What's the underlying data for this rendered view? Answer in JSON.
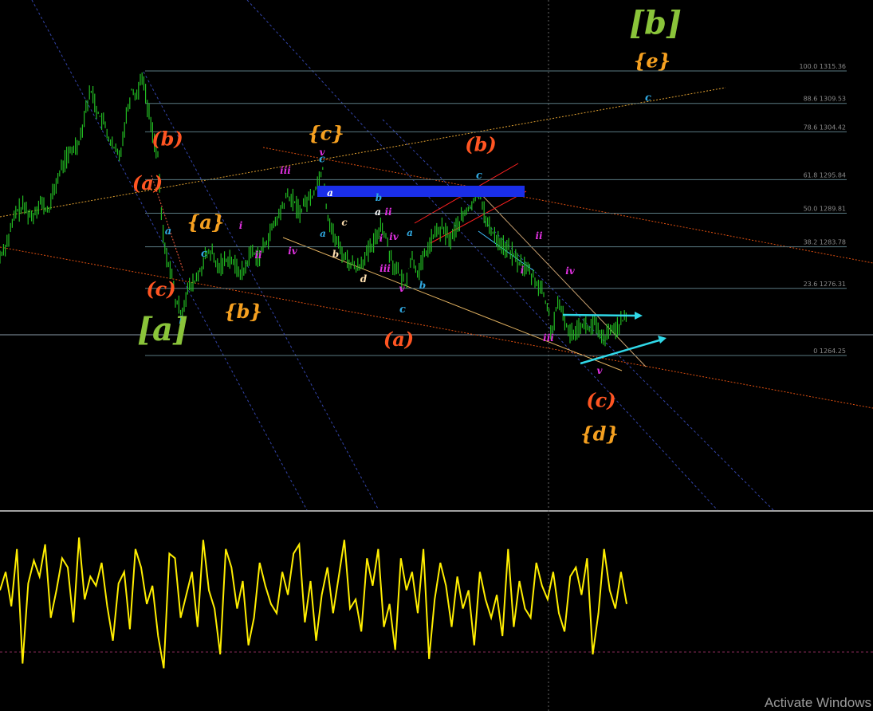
{
  "chart_data": [
    {
      "type": "line",
      "panel": "price",
      "title": "",
      "colors": {
        "bars": "#22bb22",
        "background": "#000000",
        "fib_lines": "#5a7a82"
      },
      "fib_levels": [
        {
          "label": "100.0 1315.36",
          "price": 1315.36
        },
        {
          "label": "88.6 1309.53",
          "price": 1309.53
        },
        {
          "label": "78.6 1304.42",
          "price": 1304.42
        },
        {
          "label": "61.8 1295.84",
          "price": 1295.84
        },
        {
          "label": "50.0 1289.81",
          "price": 1289.81
        },
        {
          "label": "38.2 1283.78",
          "price": 1283.78
        },
        {
          "label": "23.6 1276.31",
          "price": 1276.31
        },
        {
          "label": "0 1264.25",
          "price": 1264.25
        }
      ],
      "price_path": [
        [
          0,
          1282
        ],
        [
          10,
          1285
        ],
        [
          20,
          1290
        ],
        [
          30,
          1291
        ],
        [
          40,
          1289
        ],
        [
          50,
          1292
        ],
        [
          60,
          1290
        ],
        [
          70,
          1295
        ],
        [
          80,
          1299
        ],
        [
          90,
          1301
        ],
        [
          100,
          1303
        ],
        [
          108,
          1309
        ],
        [
          115,
          1312
        ],
        [
          122,
          1308
        ],
        [
          130,
          1306
        ],
        [
          140,
          1302
        ],
        [
          150,
          1300
        ],
        [
          158,
          1307
        ],
        [
          165,
          1312
        ],
        [
          172,
          1311
        ],
        [
          178,
          1315
        ],
        [
          185,
          1309
        ],
        [
          192,
          1304
        ],
        [
          198,
          1300
        ],
        [
          203,
          1288
        ],
        [
          208,
          1282
        ],
        [
          214,
          1280
        ],
        [
          220,
          1274
        ],
        [
          228,
          1272
        ],
        [
          235,
          1276
        ],
        [
          242,
          1277
        ],
        [
          250,
          1279
        ],
        [
          258,
          1282
        ],
        [
          265,
          1283
        ],
        [
          272,
          1280
        ],
        [
          280,
          1281
        ],
        [
          288,
          1282
        ],
        [
          296,
          1280
        ],
        [
          305,
          1279
        ],
        [
          315,
          1283
        ],
        [
          325,
          1282
        ],
        [
          335,
          1285
        ],
        [
          345,
          1288
        ],
        [
          352,
          1290
        ],
        [
          360,
          1293
        ],
        [
          368,
          1292
        ],
        [
          376,
          1290
        ],
        [
          384,
          1292
        ],
        [
          392,
          1293
        ],
        [
          400,
          1296
        ],
        [
          405,
          1298
        ],
        [
          410,
          1290
        ],
        [
          418,
          1286
        ],
        [
          428,
          1283
        ],
        [
          438,
          1281
        ],
        [
          448,
          1280
        ],
        [
          458,
          1282
        ],
        [
          468,
          1284
        ],
        [
          478,
          1288
        ],
        [
          485,
          1285
        ],
        [
          492,
          1281
        ],
        [
          500,
          1279
        ],
        [
          508,
          1277
        ],
        [
          516,
          1282
        ],
        [
          525,
          1279
        ],
        [
          535,
          1283
        ],
        [
          545,
          1286
        ],
        [
          555,
          1287
        ],
        [
          565,
          1285
        ],
        [
          575,
          1288
        ],
        [
          585,
          1290
        ],
        [
          595,
          1292
        ],
        [
          602,
          1294
        ],
        [
          610,
          1288
        ],
        [
          620,
          1286
        ],
        [
          630,
          1284
        ],
        [
          640,
          1283
        ],
        [
          650,
          1281
        ],
        [
          660,
          1280
        ],
        [
          670,
          1278
        ],
        [
          680,
          1276
        ],
        [
          688,
          1272
        ],
        [
          692,
          1268
        ],
        [
          698,
          1273
        ],
        [
          706,
          1272
        ],
        [
          714,
          1268
        ],
        [
          722,
          1269
        ],
        [
          730,
          1270
        ],
        [
          738,
          1269
        ],
        [
          746,
          1270
        ],
        [
          754,
          1267
        ],
        [
          762,
          1268
        ],
        [
          770,
          1269
        ],
        [
          778,
          1270
        ],
        [
          786,
          1271
        ]
      ],
      "wave_labels": [
        {
          "text": "[b]",
          "color": "#8ac43a",
          "at": [
            822,
            1322
          ],
          "size": "xl"
        },
        {
          "text": "{e}",
          "color": "#f5a020",
          "at": [
            818,
            1316
          ],
          "size": "l"
        },
        {
          "text": "c",
          "color": "#30a8e0",
          "at": [
            813,
            1310
          ],
          "size": "s"
        },
        {
          "text": "(b)",
          "color": "#ff5522",
          "at": [
            210,
            1302
          ],
          "size": "l"
        },
        {
          "text": "(a)",
          "color": "#ff5522",
          "at": [
            185,
            1294
          ],
          "size": "l"
        },
        {
          "text": "a",
          "color": "#30a8e0",
          "at": [
            211,
            1286
          ],
          "size": "s"
        },
        {
          "text": "{a}",
          "color": "#f5a020",
          "at": [
            258,
            1287
          ],
          "size": "l"
        },
        {
          "text": "c",
          "color": "#30a8e0",
          "at": [
            256,
            1282
          ],
          "size": "s"
        },
        {
          "text": "(c)",
          "color": "#ff5522",
          "at": [
            202,
            1275
          ],
          "size": "l"
        },
        {
          "text": "b",
          "color": "#30a8e0",
          "at": [
            229,
            1270
          ],
          "size": "s"
        },
        {
          "text": "[a]",
          "color": "#8ac43a",
          "at": [
            204,
            1267
          ],
          "size": "xl"
        },
        {
          "text": "{b}",
          "color": "#f5a020",
          "at": [
            305,
            1271
          ],
          "size": "l"
        },
        {
          "text": "{c}",
          "color": "#f5a020",
          "at": [
            409,
            1303
          ],
          "size": "l"
        },
        {
          "text": "c",
          "color": "#30a8e0",
          "at": [
            404,
            1299
          ],
          "size": "s"
        },
        {
          "text": "(b)",
          "color": "#ff5522",
          "at": [
            603,
            1301
          ],
          "size": "l"
        },
        {
          "text": "c",
          "color": "#30a8e0",
          "at": [
            601,
            1296
          ],
          "size": "s"
        },
        {
          "text": "(a)",
          "color": "#ff5522",
          "at": [
            500,
            1266
          ],
          "size": "l"
        },
        {
          "text": "c",
          "color": "#30a8e0",
          "at": [
            505,
            1272
          ],
          "size": "s"
        },
        {
          "text": "(c)",
          "color": "#ff5522",
          "at": [
            754,
            1255
          ],
          "size": "l"
        },
        {
          "text": "{d}",
          "color": "#f5a020",
          "at": [
            752,
            1249
          ],
          "size": "l"
        }
      ]
    },
    {
      "type": "line",
      "panel": "oscillator",
      "colors": {
        "line": "#ffee00"
      },
      "y": [
        52,
        60,
        45,
        70,
        20,
        55,
        65,
        58,
        72,
        40,
        52,
        66,
        62,
        38,
        75,
        48,
        58,
        54,
        64,
        45,
        30,
        55,
        60,
        35,
        70,
        62,
        46,
        54,
        32,
        18,
        68,
        66,
        40,
        50,
        60,
        36,
        74,
        52,
        44,
        24,
        70,
        62,
        44,
        56,
        28,
        40,
        64,
        54,
        46,
        42,
        60,
        50,
        68,
        72,
        38,
        56,
        30,
        50,
        62,
        42,
        58,
        74,
        44,
        48,
        34,
        66,
        54,
        70,
        36,
        46,
        26,
        66,
        52,
        60,
        42,
        70,
        22,
        48,
        64,
        54,
        36,
        58,
        44,
        52,
        28,
        60,
        48,
        40,
        50,
        32,
        70,
        36,
        56,
        44,
        40,
        64,
        54,
        48,
        60,
        42,
        34,
        58,
        62,
        50,
        66,
        24,
        42,
        70,
        52,
        44,
        60,
        46
      ]
    }
  ]
}
